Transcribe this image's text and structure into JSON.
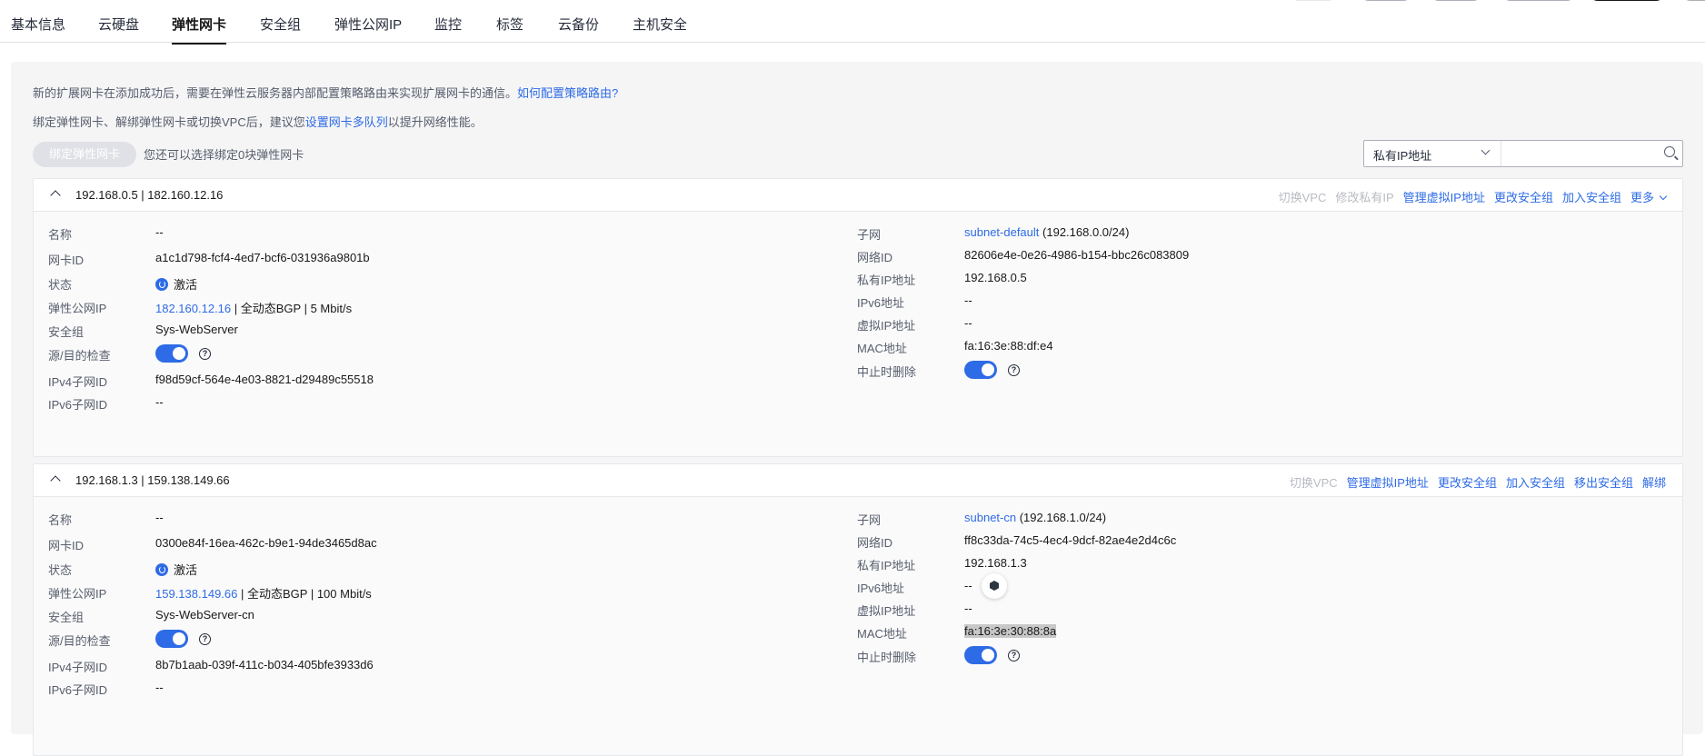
{
  "tabs": [
    "基本信息",
    "云硬盘",
    "弹性网卡",
    "安全组",
    "弹性公网IP",
    "监控",
    "标签",
    "云备份",
    "主机安全"
  ],
  "active_tab": "弹性网卡",
  "tips": {
    "line1_text": "新的扩展网卡在添加成功后，需要在弹性云服务器内部配置策略路由来实现扩展网卡的通信。",
    "line1_link": "如何配置策略路由?",
    "line2_pre": "绑定弹性网卡、解绑弹性网卡或切换VPC后，建议您",
    "line2_link": "设置网卡多队列",
    "line2_post": "以提升网络性能。"
  },
  "toolbar": {
    "bind_button": "绑定弹性网卡",
    "bind_hint": "您还可以选择绑定0块弹性网卡",
    "search_filter": "私有IP地址",
    "search_placeholder": ""
  },
  "labels": {
    "name": "名称",
    "nic_id": "网卡ID",
    "status": "状态",
    "eip": "弹性公网IP",
    "security_group": "安全组",
    "src_dst_check": "源/目的检查",
    "ipv4_subnet_id": "IPv4子网ID",
    "ipv6_subnet_id": "IPv6子网ID",
    "subnet": "子网",
    "network_id": "网络ID",
    "private_ip": "私有IP地址",
    "ipv6_address": "IPv6地址",
    "virtual_ip": "虚拟IP地址",
    "mac": "MAC地址",
    "delete_on_termination": "中止时删除"
  },
  "help_glyph": "?",
  "nics": [
    {
      "title": "192.168.0.5 | 182.160.12.16",
      "actions": [
        {
          "label": "切换VPC",
          "enabled": false
        },
        {
          "label": "修改私有IP",
          "enabled": false
        },
        {
          "label": "管理虚拟IP地址",
          "enabled": true
        },
        {
          "label": "更改安全组",
          "enabled": true
        },
        {
          "label": "加入安全组",
          "enabled": true
        }
      ],
      "more_label": "更多",
      "name": "--",
      "nic_id": "a1c1d798-fcf4-4ed7-bcf6-031936a9801b",
      "status": "激活",
      "eip": "182.160.12.16",
      "eip_sep1": "| 全动态BGP |",
      "eip_bandwidth": "5 Mbit/s",
      "security_group": "Sys-WebServer",
      "ipv4_subnet_id": "f98d59cf-564e-4e03-8821-d29489c55518",
      "ipv6_subnet_id": "--",
      "subnet_name": "subnet-default",
      "subnet_cidr": "(192.168.0.0/24)",
      "network_id": "82606e4e-0e26-4986-b154-bbc26c083809",
      "private_ip": "192.168.0.5",
      "ipv6_address": "--",
      "virtual_ip": "--",
      "mac": "fa:16:3e:88:df:e4"
    },
    {
      "title": "192.168.1.3 | 159.138.149.66",
      "actions": [
        {
          "label": "切换VPC",
          "enabled": false
        },
        {
          "label": "管理虚拟IP地址",
          "enabled": true
        },
        {
          "label": "更改安全组",
          "enabled": true
        },
        {
          "label": "加入安全组",
          "enabled": true
        },
        {
          "label": "移出安全组",
          "enabled": true
        },
        {
          "label": "解绑",
          "enabled": true
        }
      ],
      "name": "--",
      "nic_id": "0300e84f-16ea-462c-b9e1-94de3465d8ac",
      "status": "激活",
      "eip": "159.138.149.66",
      "eip_sep1": "| 全动态BGP |",
      "eip_bandwidth": "100 Mbit/s",
      "security_group": "Sys-WebServer-cn",
      "ipv4_subnet_id": "8b7b1aab-039f-411c-b034-405bfe3933d6",
      "ipv6_subnet_id": "--",
      "subnet_name": "subnet-cn",
      "subnet_cidr": "(192.168.1.0/24)",
      "network_id": "ff8c33da-74c5-4ec4-9dcf-82ae4e2d4c6c",
      "private_ip": "192.168.1.3",
      "ipv6_address": "--",
      "virtual_ip": "--",
      "mac": "fa:16:3e:30:88:8a"
    }
  ]
}
